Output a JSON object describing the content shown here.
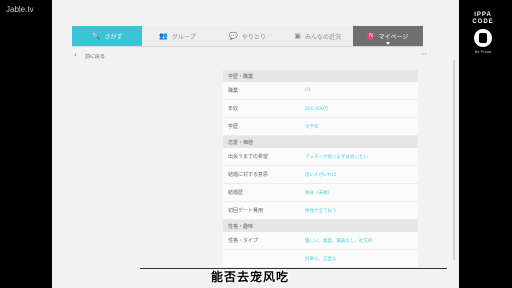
{
  "watermark": "Jable.tv",
  "brand": {
    "line1": "IPPA",
    "line2": "CODE",
    "sub": "Be Proud"
  },
  "tabs": [
    {
      "icon": "search",
      "glyph": "🔍",
      "label": "さがす",
      "active": true
    },
    {
      "icon": "group",
      "glyph": "👥",
      "label": "グループ",
      "active": false
    },
    {
      "icon": "chat",
      "glyph": "💬",
      "label": "やりとり",
      "active": false
    },
    {
      "icon": "news",
      "glyph": "▣",
      "label": "みんなの近況",
      "active": false
    },
    {
      "icon": "mypage",
      "glyph": "▢",
      "label": "マイページ",
      "badge": "N",
      "active": false
    }
  ],
  "back_label": "前に戻る",
  "sections": [
    {
      "title": "学歴・職業",
      "rows": [
        {
          "label": "職業",
          "value": "OL"
        },
        {
          "label": "年収",
          "value": "200-400万"
        },
        {
          "label": "学歴",
          "value": "大学卒"
        }
      ]
    },
    {
      "title": "恋愛・価値",
      "rows": [
        {
          "label": "出会うまでの希望",
          "value": "マッチング後にまずは会いたい"
        },
        {
          "label": "結婚に対する意思",
          "value": "良い人がいれば"
        },
        {
          "label": "結婚歴",
          "value": "独身（未婚）"
        },
        {
          "label": "初回デート費用",
          "value": "男性が全て払う"
        }
      ]
    },
    {
      "title": "性格・趣味",
      "rows": [
        {
          "label": "性格・タイプ",
          "value": "優しい、素直、裏表なし、社交的"
        },
        {
          "label": "",
          "value": "好奇心、正直な"
        }
      ]
    }
  ],
  "subtitle": "能否去宠风吃"
}
